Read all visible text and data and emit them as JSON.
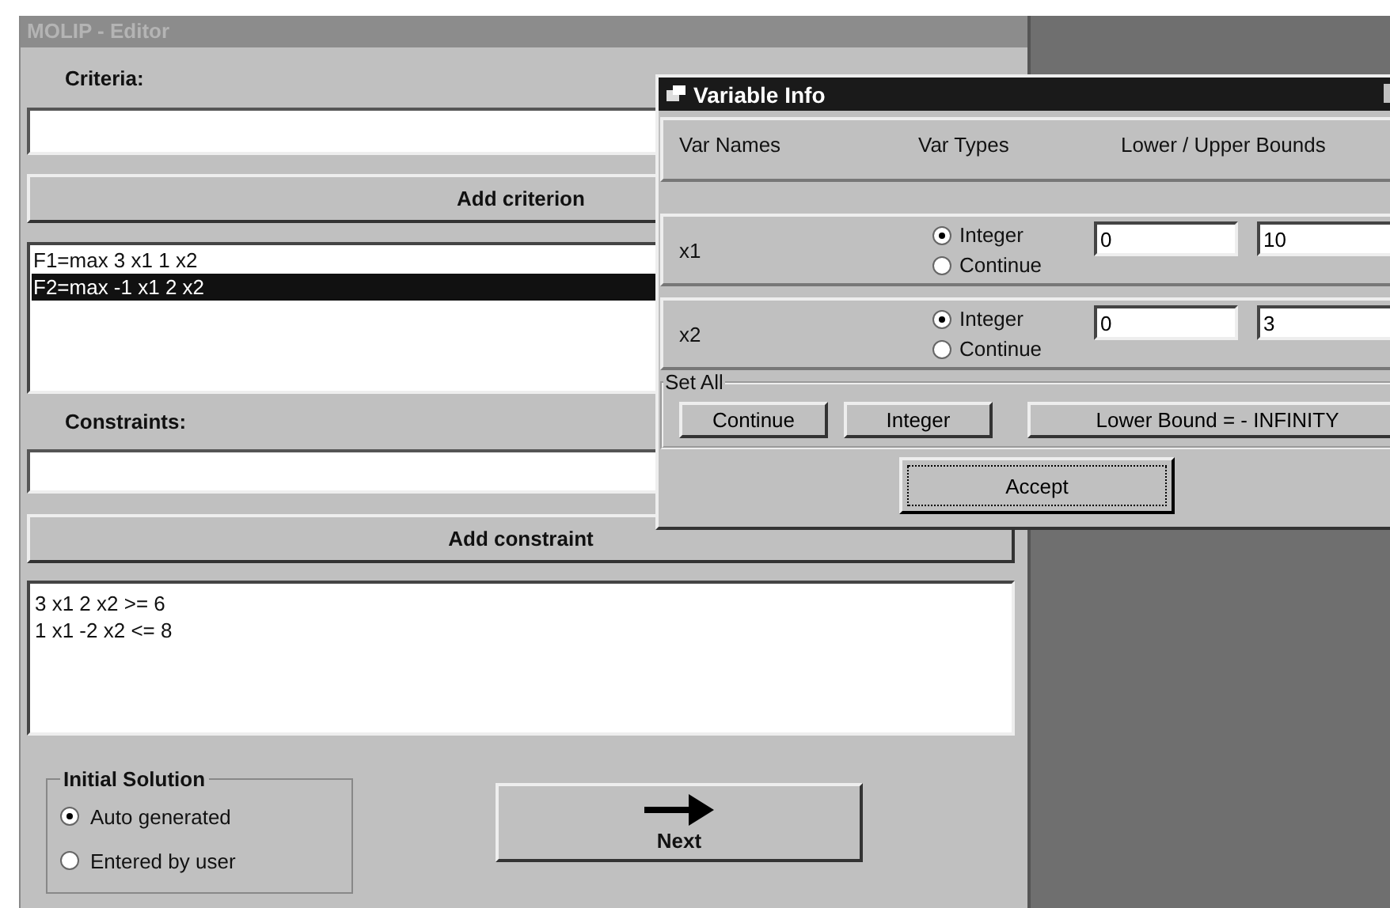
{
  "editor": {
    "title": "MOLIP - Editor",
    "criteria_label": "Criteria:",
    "add_criterion_button": "Add criterion",
    "criteria_list": [
      {
        "text": "F1=max 3 x1 1 x2",
        "selected": false
      },
      {
        "text": "F2=max -1 x1 2 x2",
        "selected": true
      }
    ],
    "constraints_label": "Constraints:",
    "add_constraint_button": "Add constraint",
    "constraints_list": [
      {
        "text": "3 x1 2 x2 >= 6",
        "selected": false
      },
      {
        "text": "1 x1 -2 x2 <= 8",
        "selected": false
      }
    ],
    "initial_solution": {
      "title": "Initial Solution",
      "options": [
        {
          "label": "Auto generated",
          "selected": true
        },
        {
          "label": "Entered by user",
          "selected": false
        }
      ]
    },
    "next_button": "Next"
  },
  "dialog": {
    "title": "Variable Info",
    "columns": [
      "Var Names",
      "Var Types",
      "Lower / Upper Bounds"
    ],
    "variables": [
      {
        "name": "x1",
        "types": [
          {
            "label": "Integer",
            "selected": true
          },
          {
            "label": "Continue",
            "selected": false
          }
        ],
        "lower": "0",
        "upper": "10"
      },
      {
        "name": "x2",
        "types": [
          {
            "label": "Integer",
            "selected": true
          },
          {
            "label": "Continue",
            "selected": false
          }
        ],
        "lower": "0",
        "upper": "3"
      }
    ],
    "set_all": {
      "title": "Set All",
      "buttons": [
        "Continue",
        "Integer",
        "Lower Bound = - INFINITY"
      ]
    },
    "accept_button": "Accept"
  }
}
